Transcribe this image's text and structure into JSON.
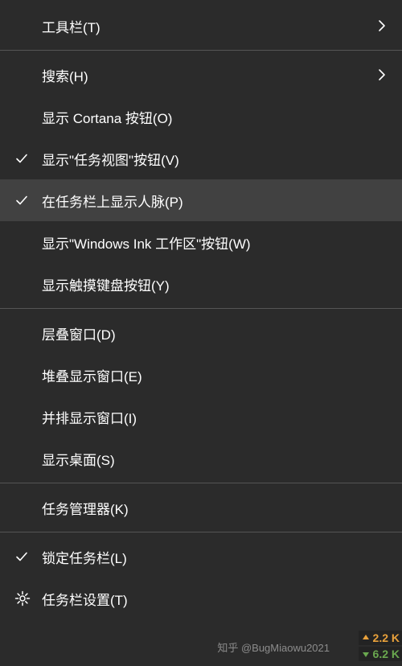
{
  "menu": {
    "groups": [
      [
        {
          "id": "toolbars",
          "label": "工具栏(T)",
          "checked": false,
          "submenu": true,
          "icon": null
        }
      ],
      [
        {
          "id": "search",
          "label": "搜索(H)",
          "checked": false,
          "submenu": true,
          "icon": null
        },
        {
          "id": "cortana-button",
          "label": "显示 Cortana 按钮(O)",
          "checked": false,
          "submenu": false,
          "icon": null
        },
        {
          "id": "task-view-button",
          "label": "显示\"任务视图\"按钮(V)",
          "checked": true,
          "submenu": false,
          "icon": null
        },
        {
          "id": "people-on-taskbar",
          "label": "在任务栏上显示人脉(P)",
          "checked": true,
          "submenu": false,
          "icon": null,
          "highlighted": true
        },
        {
          "id": "windows-ink-button",
          "label": "显示\"Windows Ink 工作区\"按钮(W)",
          "checked": false,
          "submenu": false,
          "icon": null
        },
        {
          "id": "touch-keyboard-button",
          "label": "显示触摸键盘按钮(Y)",
          "checked": false,
          "submenu": false,
          "icon": null
        }
      ],
      [
        {
          "id": "cascade-windows",
          "label": "层叠窗口(D)",
          "checked": false,
          "submenu": false,
          "icon": null
        },
        {
          "id": "stack-windows",
          "label": "堆叠显示窗口(E)",
          "checked": false,
          "submenu": false,
          "icon": null
        },
        {
          "id": "side-by-side-windows",
          "label": "并排显示窗口(I)",
          "checked": false,
          "submenu": false,
          "icon": null
        },
        {
          "id": "show-desktop",
          "label": "显示桌面(S)",
          "checked": false,
          "submenu": false,
          "icon": null
        }
      ],
      [
        {
          "id": "task-manager",
          "label": "任务管理器(K)",
          "checked": false,
          "submenu": false,
          "icon": null
        }
      ],
      [
        {
          "id": "lock-taskbar",
          "label": "锁定任务栏(L)",
          "checked": true,
          "submenu": false,
          "icon": null
        },
        {
          "id": "taskbar-settings",
          "label": "任务栏设置(T)",
          "checked": false,
          "submenu": false,
          "icon": "gear"
        }
      ]
    ]
  },
  "watermark": "知乎 @BugMiaowu2021",
  "badges": {
    "up": "2.2 K",
    "down": "6.2 K"
  }
}
